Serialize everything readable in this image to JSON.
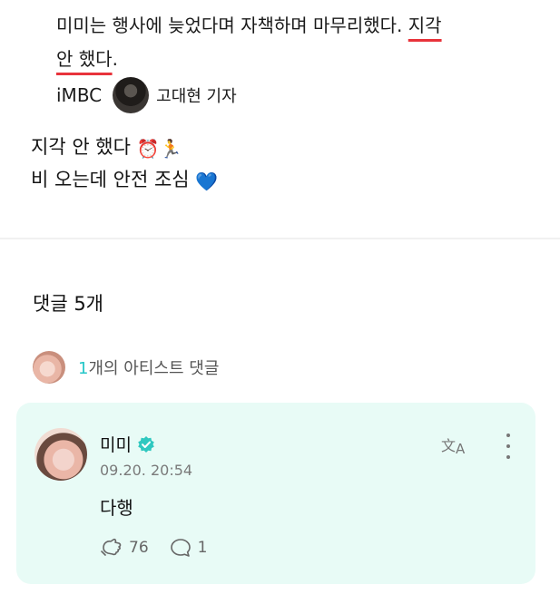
{
  "article_quote": {
    "line1_text": "미미는 행사에 늦었다며 자책하며 마무리했다. ",
    "line1_highlight": "지각",
    "line2_highlight": "안 했다",
    "line2_tail": ".",
    "outlet": "iMBC",
    "reporter": "고대현 기자"
  },
  "post": {
    "line1": "지각 안 했다",
    "line1_emoji_1": "⏰",
    "line1_emoji_2": "🏃",
    "line2": "비 오는데 안전 조심",
    "line2_emoji": "💙"
  },
  "comments": {
    "title": "댓글 5개",
    "artist_summary_count": "1",
    "artist_summary_text": "개의 아티스트 댓글",
    "items": [
      {
        "author": "미미",
        "timestamp": "09.20. 20:54",
        "text": "다행",
        "likes": "76",
        "replies": "1"
      }
    ]
  },
  "colors": {
    "highlight_underline": "#e8333b",
    "accent_teal": "#24c6c8",
    "card_background": "#e8fbf6",
    "verified_badge": "#2fc8c0"
  },
  "icons": [
    "reporter-photo",
    "alarm-clock-emoji",
    "runner-emoji",
    "blue-heart-emoji",
    "verified-icon",
    "translate-icon",
    "more-vertical-icon",
    "like-hand-icon",
    "reply-bubble-icon"
  ]
}
